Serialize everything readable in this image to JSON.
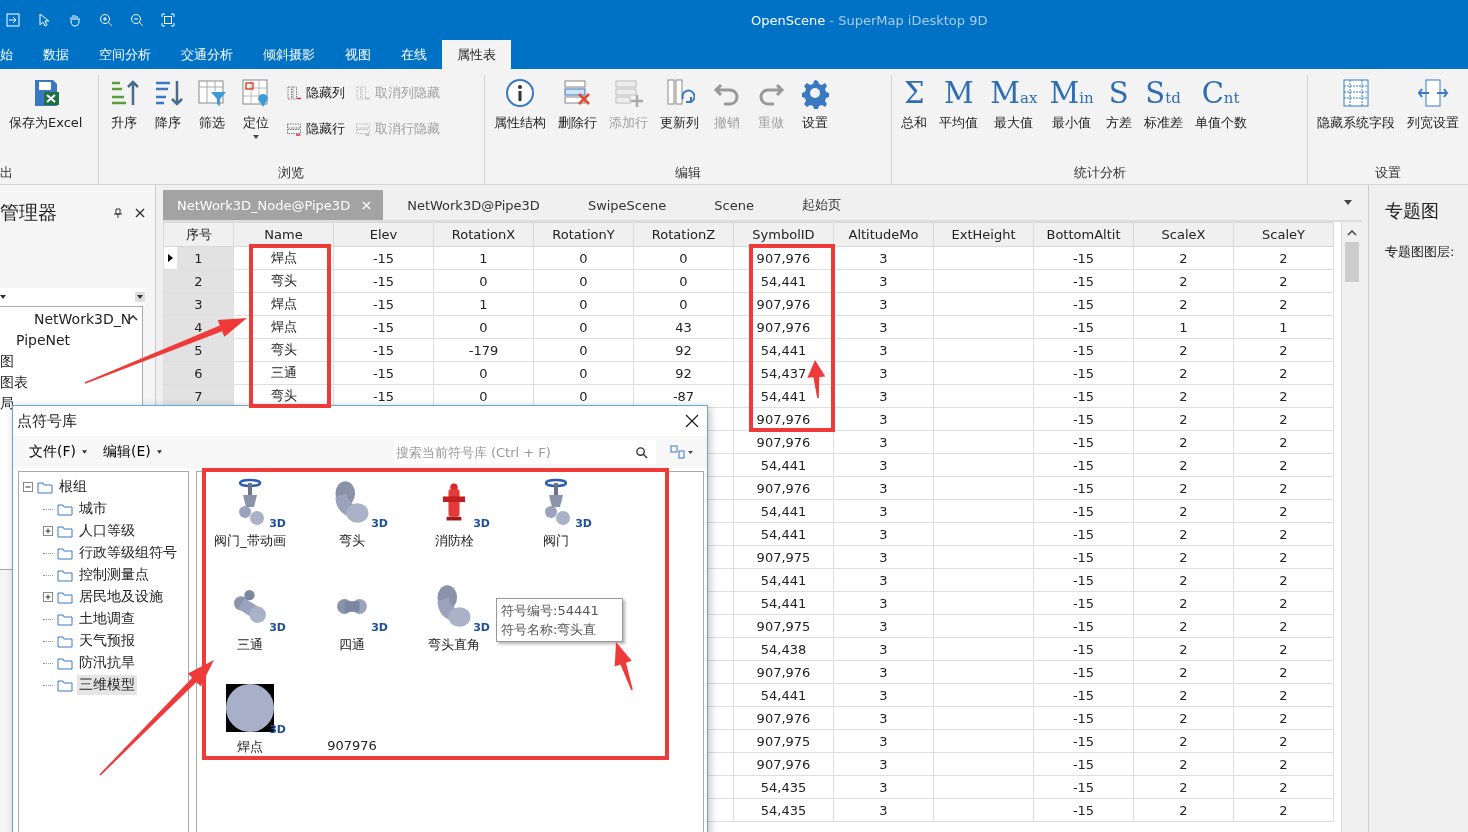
{
  "title_bar": {
    "document": "OpenScene",
    "app": "- SuperMap iDesktop 9D"
  },
  "ribbon_tabs": [
    {
      "label": "始",
      "selected": false
    },
    {
      "label": "数据",
      "selected": false
    },
    {
      "label": "空间分析",
      "selected": false
    },
    {
      "label": "交通分析",
      "selected": false
    },
    {
      "label": "倾斜摄影",
      "selected": false
    },
    {
      "label": "视图",
      "selected": false
    },
    {
      "label": "在线",
      "selected": false
    },
    {
      "label": "属性表",
      "selected": true
    }
  ],
  "ribbon_groups": [
    {
      "label": "出",
      "items": [
        {
          "kind": "large",
          "label": "保存为Excel",
          "disabled": false
        }
      ]
    },
    {
      "label": "浏览",
      "items": [
        {
          "kind": "large",
          "label": "升序",
          "disabled": false
        },
        {
          "kind": "large",
          "label": "降序",
          "disabled": false
        },
        {
          "kind": "large",
          "label": "筛选",
          "disabled": false
        },
        {
          "kind": "large",
          "label": "定位",
          "disabled": false,
          "dropdown": true
        },
        {
          "kind": "small",
          "label": "隐藏列",
          "disabled": false
        },
        {
          "kind": "small",
          "label": "隐藏行",
          "disabled": false
        },
        {
          "kind": "small",
          "label": "取消列隐藏",
          "disabled": true
        },
        {
          "kind": "small",
          "label": "取消行隐藏",
          "disabled": true
        }
      ]
    },
    {
      "label": "编辑",
      "items": [
        {
          "kind": "large",
          "label": "属性结构",
          "disabled": false
        },
        {
          "kind": "large",
          "label": "删除行",
          "disabled": false
        },
        {
          "kind": "large",
          "label": "添加行",
          "disabled": true
        },
        {
          "kind": "large",
          "label": "更新列",
          "disabled": false
        },
        {
          "kind": "large",
          "label": "撤销",
          "disabled": true
        },
        {
          "kind": "large",
          "label": "重做",
          "disabled": true
        },
        {
          "kind": "large",
          "label": "设置",
          "disabled": false
        }
      ]
    },
    {
      "label": "统计分析",
      "items": [
        {
          "kind": "glyph",
          "glyph": "Σ",
          "label": "总和",
          "disabled": false
        },
        {
          "kind": "glyph",
          "glyph": "M",
          "label": "平均值",
          "disabled": false
        },
        {
          "kind": "glyph",
          "glyph": "M",
          "sub": "ax",
          "label": "最大值",
          "disabled": false
        },
        {
          "kind": "glyph",
          "glyph": "M",
          "sub": "in",
          "label": "最小值",
          "disabled": false
        },
        {
          "kind": "glyph",
          "glyph": "S",
          "label": "方差",
          "disabled": false
        },
        {
          "kind": "glyph",
          "glyph": "S",
          "sub": "td",
          "label": "标准差",
          "disabled": false
        },
        {
          "kind": "glyph",
          "glyph": "C",
          "sub": "nt",
          "label": "单值个数",
          "disabled": false
        }
      ]
    },
    {
      "label": "设置",
      "items": [
        {
          "kind": "large",
          "label": "隐藏系统字段",
          "disabled": false
        },
        {
          "kind": "large",
          "label": "列宽设置",
          "disabled": false
        }
      ]
    }
  ],
  "left_panel": {
    "title": "管理器",
    "items": [
      "NetWork3D_N",
      "PipeNet",
      "图",
      "图表",
      "局"
    ]
  },
  "document_tabs": [
    {
      "label": "NetWork3D_Node@Pipe3D",
      "selected": true
    },
    {
      "label": "NetWork3D@Pipe3D",
      "selected": false
    },
    {
      "label": "SwipeScene",
      "selected": false
    },
    {
      "label": "Scene",
      "selected": false
    },
    {
      "label": "起始页",
      "selected": false
    }
  ],
  "table": {
    "columns": [
      "序号",
      "Name",
      "Elev",
      "RotationX",
      "RotationY",
      "RotationZ",
      "SymbolID",
      "AltitudeMo",
      "ExtHeight",
      "BottomAltit",
      "ScaleX",
      "ScaleY"
    ],
    "rows": [
      {
        "selected": true,
        "cells": [
          "1",
          "焊点",
          "-15",
          "1",
          "0",
          "0",
          "907,976",
          "3",
          null,
          "-15",
          "2",
          "2"
        ]
      },
      {
        "selected": false,
        "cells": [
          "2",
          "弯头",
          "-15",
          "0",
          "0",
          "0",
          "54,441",
          "3",
          null,
          "-15",
          "2",
          "2"
        ]
      },
      {
        "selected": false,
        "cells": [
          "3",
          "焊点",
          "-15",
          "1",
          "0",
          "0",
          "907,976",
          "3",
          null,
          "-15",
          "2",
          "2"
        ]
      },
      {
        "selected": false,
        "cells": [
          "4",
          "焊点",
          "-15",
          "0",
          "0",
          "43",
          "907,976",
          "3",
          null,
          "-15",
          "1",
          "1"
        ]
      },
      {
        "selected": false,
        "cells": [
          "5",
          "弯头",
          "-15",
          "-179",
          "0",
          "92",
          "54,441",
          "3",
          null,
          "-15",
          "2",
          "2"
        ]
      },
      {
        "selected": false,
        "cells": [
          "6",
          "三通",
          "-15",
          "0",
          "0",
          "92",
          "54,437",
          "3",
          null,
          "-15",
          "2",
          "2"
        ]
      },
      {
        "selected": false,
        "cells": [
          "7",
          "弯头",
          "-15",
          "0",
          "0",
          "-87",
          "54,441",
          "3",
          null,
          "-15",
          "2",
          "2"
        ]
      }
    ],
    "rows_behind_dialog": [
      {
        "cells": [
          "907,976",
          "3",
          null,
          "-15",
          "2",
          "2"
        ]
      },
      {
        "cells": [
          "907,976",
          "3",
          null,
          "-15",
          "2",
          "2"
        ]
      },
      {
        "cells": [
          "54,441",
          "3",
          null,
          "-15",
          "2",
          "2"
        ]
      },
      {
        "cells": [
          "907,976",
          "3",
          null,
          "-15",
          "2",
          "2"
        ]
      },
      {
        "cells": [
          "54,441",
          "3",
          null,
          "-15",
          "2",
          "2"
        ]
      },
      {
        "cells": [
          "54,441",
          "3",
          null,
          "-15",
          "2",
          "2"
        ]
      },
      {
        "cells": [
          "907,975",
          "3",
          null,
          "-15",
          "2",
          "2"
        ]
      },
      {
        "cells": [
          "54,441",
          "3",
          null,
          "-15",
          "2",
          "2"
        ]
      },
      {
        "cells": [
          "54,441",
          "3",
          null,
          "-15",
          "2",
          "2"
        ]
      },
      {
        "cells": [
          "907,975",
          "3",
          null,
          "-15",
          "2",
          "2"
        ]
      },
      {
        "cells": [
          "54,438",
          "3",
          null,
          "-15",
          "2",
          "2"
        ]
      },
      {
        "cells": [
          "907,976",
          "3",
          null,
          "-15",
          "2",
          "2"
        ]
      },
      {
        "cells": [
          "54,441",
          "3",
          null,
          "-15",
          "2",
          "2"
        ]
      },
      {
        "cells": [
          "907,976",
          "3",
          null,
          "-15",
          "2",
          "2"
        ]
      },
      {
        "cells": [
          "907,975",
          "3",
          null,
          "-15",
          "2",
          "2"
        ]
      },
      {
        "cells": [
          "907,976",
          "3",
          null,
          "-15",
          "2",
          "2"
        ]
      },
      {
        "cells": [
          "54,435",
          "3",
          null,
          "-15",
          "2",
          "2"
        ]
      },
      {
        "cells": [
          "54,435",
          "3",
          null,
          "-15",
          "2",
          "2"
        ]
      }
    ]
  },
  "right_panel": {
    "title": "专题图",
    "label": "专题图图层:"
  },
  "dialog": {
    "title": "点符号库",
    "menus": [
      "文件(F)",
      "编辑(E)"
    ],
    "search": {
      "placeholder": "搜索当前符号库 (Ctrl + F)"
    },
    "tree": {
      "label": "根组",
      "expanded": true,
      "selected": false,
      "children": [
        {
          "label": "城市",
          "expandable": false,
          "selected": false
        },
        {
          "label": "人口等级",
          "expandable": true,
          "selected": false
        },
        {
          "label": "行政等级组符号",
          "expandable": false,
          "selected": false
        },
        {
          "label": "控制测量点",
          "expandable": false,
          "selected": false
        },
        {
          "label": "居民地及设施",
          "expandable": true,
          "selected": false
        },
        {
          "label": "土地调查",
          "expandable": false,
          "selected": false
        },
        {
          "label": "天气预报",
          "expandable": false,
          "selected": false
        },
        {
          "label": "防汛抗旱",
          "expandable": false,
          "selected": false
        },
        {
          "label": "三维模型",
          "expandable": false,
          "selected": true
        }
      ]
    },
    "symbol_rows": [
      [
        {
          "label": "阀门_带动画",
          "badge": "3D"
        },
        {
          "label": "弯头",
          "badge": "3D"
        },
        {
          "label": "消防栓",
          "badge": "3D"
        },
        {
          "label": "阀门",
          "badge": "3D"
        }
      ],
      [
        {
          "label": "三通",
          "badge": "3D"
        },
        {
          "label": "四通",
          "badge": "3D"
        },
        {
          "label": "弯头直角",
          "badge": "3D"
        }
      ],
      [
        {
          "label": "焊点",
          "badge": "3D"
        },
        {
          "label": "907976"
        }
      ]
    ],
    "tooltip": [
      "符号编号:54441",
      "符号名称:弯头直"
    ]
  }
}
